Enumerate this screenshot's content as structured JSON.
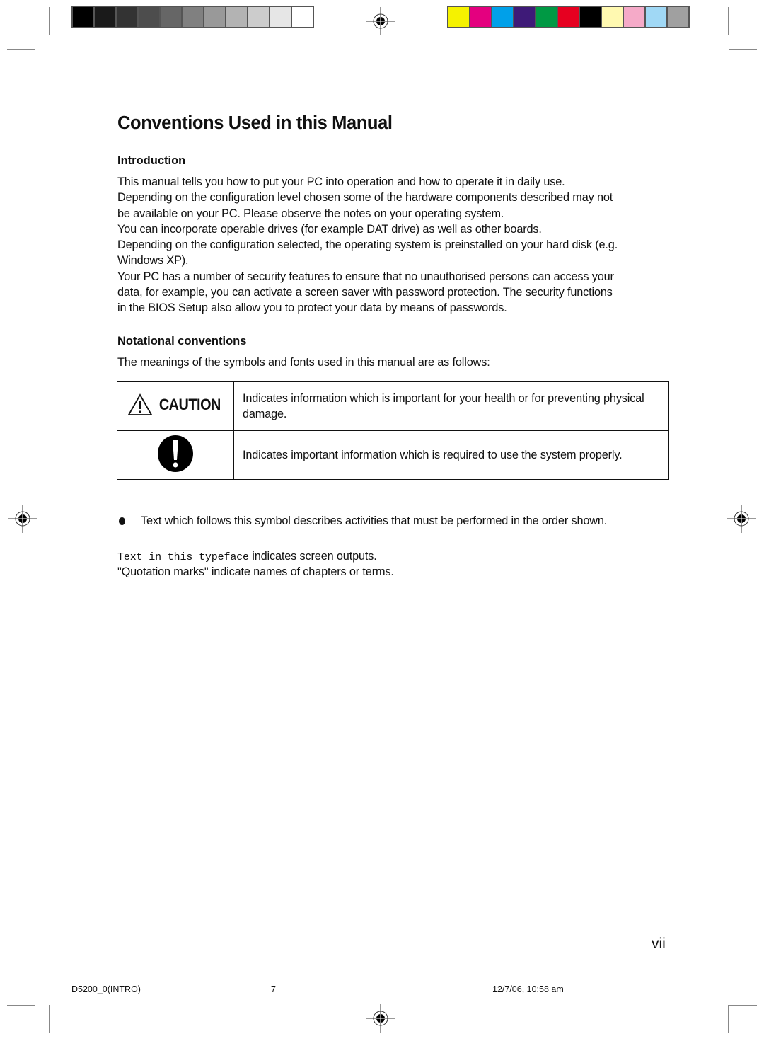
{
  "print_marks": {
    "grayscale_swatches": [
      "#000000",
      "#1a1a1a",
      "#333333",
      "#4d4d4d",
      "#666666",
      "#808080",
      "#999999",
      "#b3b3b3",
      "#cccccc",
      "#e6e6e6",
      "#ffffff"
    ],
    "color_swatches": [
      "#f5f200",
      "#e4007f",
      "#00a0e9",
      "#3e1a78",
      "#009944",
      "#e60020",
      "#000000",
      "#fff9b1",
      "#f5aac8",
      "#a0d8f5",
      "#a0a0a0"
    ]
  },
  "page": {
    "title": "Conventions Used in this Manual",
    "introduction": {
      "heading": "Introduction",
      "lines": [
        "This manual tells you how to put your PC into operation and how to operate it in daily use.",
        "Depending on the configuration level chosen some of the hardware components described may not",
        "be available on your PC. Please observe the notes on your operating system.",
        "You can incorporate operable drives (for example DAT drive) as well as other boards.",
        "Depending on the configuration selected, the operating system is preinstalled on your hard disk (e.g.",
        "Windows XP).",
        "Your PC has a number of security features to ensure that no unauthorised persons can access your",
        "data, for example, you can activate a screen saver with password protection. The security functions",
        "in the BIOS Setup also allow you to protect your data by means of passwords."
      ]
    },
    "notational": {
      "heading": "Notational conventions",
      "intro": "The meanings of the symbols and fonts used in this manual are as follows:",
      "table": [
        {
          "symbol": "caution-icon",
          "symbol_label": "CAUTION",
          "description": "Indicates information which is important for your health or for preventing physical damage."
        },
        {
          "symbol": "exclamation-icon",
          "description": "Indicates important information which is required to use the system properly."
        }
      ],
      "bullet_text": "Text which follows this symbol describes activities that must be performed in the order shown.",
      "typeface_sample": "Text in this typeface",
      "typeface_rest": " indicates screen outputs.",
      "quotation_text": "\"Quotation marks\" indicate names of chapters or terms."
    },
    "page_number": "vii"
  },
  "footer": {
    "file": "D5200_0(INTRO)",
    "sheet": "7",
    "timestamp": "12/7/06, 10:58 am"
  }
}
